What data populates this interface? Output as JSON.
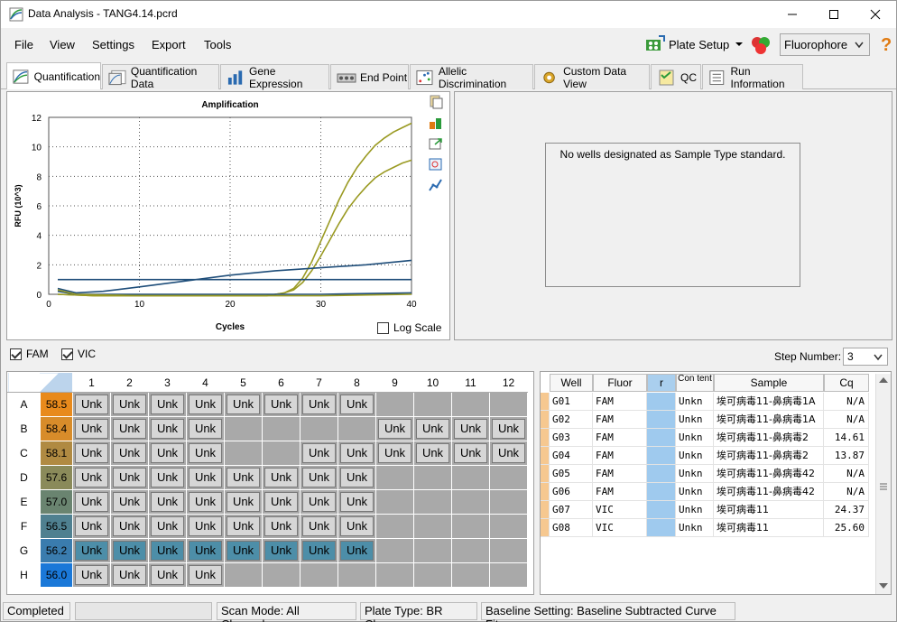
{
  "window": {
    "title": "Data Analysis - TANG4.14.pcrd"
  },
  "menu": {
    "file": "File",
    "view": "View",
    "settings": "Settings",
    "export": "Export",
    "tools": "Tools"
  },
  "toolbar": {
    "plate_setup": "Plate Setup",
    "fluorophore": "Fluorophore"
  },
  "tabs": [
    "Quantification",
    "Quantification Data",
    "Gene Expression",
    "End Point",
    "Allelic Discrimination",
    "Custom Data View",
    "QC",
    "Run Information"
  ],
  "chart_data": {
    "type": "line",
    "title": "Amplification",
    "xlabel": "Cycles",
    "ylabel": "RFU (10^3)",
    "xlim": [
      0,
      40
    ],
    "ylim": [
      0,
      12
    ],
    "xticks": [
      0,
      10,
      20,
      30,
      40
    ],
    "yticks": [
      0,
      2,
      4,
      6,
      8,
      10,
      12
    ],
    "grid": true,
    "series": [
      {
        "color": "#9a9a22",
        "x": [
          1,
          5,
          10,
          15,
          20,
          22,
          24,
          25,
          26,
          27,
          28,
          29,
          30,
          31,
          32,
          33,
          34,
          35,
          36,
          37,
          38,
          39,
          40
        ],
        "y": [
          0,
          -0.1,
          -0.1,
          -0.1,
          -0.1,
          -0.1,
          -0.1,
          0,
          0.1,
          0.4,
          1.1,
          2.2,
          3.6,
          5.0,
          6.4,
          7.6,
          8.6,
          9.4,
          10.1,
          10.6,
          11.0,
          11.3,
          11.6
        ]
      },
      {
        "color": "#9a9a22",
        "x": [
          1,
          5,
          10,
          15,
          20,
          22,
          24,
          25,
          26,
          27,
          28,
          29,
          30,
          31,
          32,
          33,
          34,
          35,
          36,
          37,
          38,
          39,
          40
        ],
        "y": [
          0,
          -0.1,
          -0.1,
          -0.1,
          -0.1,
          -0.1,
          -0.1,
          0,
          0.1,
          0.3,
          0.8,
          1.6,
          2.6,
          3.7,
          4.8,
          5.8,
          6.6,
          7.3,
          7.9,
          8.3,
          8.6,
          8.9,
          9.1
        ]
      },
      {
        "color": "#1f4e7a",
        "x": [
          1,
          40
        ],
        "y": [
          1.0,
          1.0
        ]
      },
      {
        "color": "#1f4e7a",
        "x": [
          1,
          3,
          6,
          10,
          15,
          20,
          25,
          30,
          35,
          40
        ],
        "y": [
          0.4,
          0.1,
          0.2,
          0.5,
          0.9,
          1.3,
          1.6,
          1.8,
          2.0,
          2.3
        ]
      },
      {
        "color": "#1f4e7a",
        "x": [
          1,
          3,
          10,
          20,
          30,
          40
        ],
        "y": [
          0.2,
          0,
          0,
          0,
          0,
          0.1
        ]
      },
      {
        "color": "#9a9a22",
        "x": [
          1,
          3,
          10,
          20,
          30,
          40
        ],
        "y": [
          0.3,
          0,
          -0.1,
          -0.1,
          -0.1,
          0
        ]
      }
    ]
  },
  "log_scale": {
    "label": "Log Scale",
    "checked": false
  },
  "standard_message": "No wells designated as Sample Type standard.",
  "fluor_filters": [
    {
      "label": "FAM",
      "checked": true
    },
    {
      "label": "VIC",
      "checked": true
    }
  ],
  "step_number": {
    "label": "Step Number:",
    "value": "3"
  },
  "plate": {
    "columns": [
      "1",
      "2",
      "3",
      "4",
      "5",
      "6",
      "7",
      "8",
      "9",
      "10",
      "11",
      "12"
    ],
    "rows": [
      {
        "id": "A",
        "temp": "58.5",
        "color": "#e88a1c",
        "wells": [
          "Unk",
          "Unk",
          "Unk",
          "Unk",
          "Unk",
          "Unk",
          "Unk",
          "Unk",
          "",
          "",
          "",
          ""
        ],
        "selected": false
      },
      {
        "id": "B",
        "temp": "58.4",
        "color": "#d88c2a",
        "wells": [
          "Unk",
          "Unk",
          "Unk",
          "Unk",
          "",
          "",
          "",
          "",
          "Unk",
          "Unk",
          "Unk",
          "Unk"
        ],
        "selected": false
      },
      {
        "id": "C",
        "temp": "58.1",
        "color": "#b08a42",
        "wells": [
          "Unk",
          "Unk",
          "Unk",
          "Unk",
          "",
          "",
          "Unk",
          "Unk",
          "Unk",
          "Unk",
          "Unk",
          "Unk"
        ],
        "selected": false
      },
      {
        "id": "D",
        "temp": "57.6",
        "color": "#8a8a5a",
        "wells": [
          "Unk",
          "Unk",
          "Unk",
          "Unk",
          "Unk",
          "Unk",
          "Unk",
          "Unk",
          "",
          "",
          "",
          ""
        ],
        "selected": false
      },
      {
        "id": "E",
        "temp": "57.0",
        "color": "#6a8470",
        "wells": [
          "Unk",
          "Unk",
          "Unk",
          "Unk",
          "Unk",
          "Unk",
          "Unk",
          "Unk",
          "",
          "",
          "",
          ""
        ],
        "selected": false
      },
      {
        "id": "F",
        "temp": "56.5",
        "color": "#4f8090",
        "wells": [
          "Unk",
          "Unk",
          "Unk",
          "Unk",
          "Unk",
          "Unk",
          "Unk",
          "Unk",
          "",
          "",
          "",
          ""
        ],
        "selected": false
      },
      {
        "id": "G",
        "temp": "56.2",
        "color": "#3a7cae",
        "wells": [
          "Unk",
          "Unk",
          "Unk",
          "Unk",
          "Unk",
          "Unk",
          "Unk",
          "Unk",
          "",
          "",
          "",
          ""
        ],
        "selected": true
      },
      {
        "id": "H",
        "temp": "56.0",
        "color": "#1a78d8",
        "wells": [
          "Unk",
          "Unk",
          "Unk",
          "Unk",
          "",
          "",
          "",
          "",
          "",
          "",
          "",
          ""
        ],
        "selected": false
      }
    ]
  },
  "grid": {
    "headers": [
      "Well",
      "Fluor",
      "r",
      "Con tent",
      "Sample",
      "Cq"
    ],
    "rows": [
      {
        "well": "G01",
        "fluor": "FAM",
        "content": "Unkn",
        "sample": "埃可病毒11-鼻病毒1A",
        "cq": "N/A"
      },
      {
        "well": "G02",
        "fluor": "FAM",
        "content": "Unkn",
        "sample": "埃可病毒11-鼻病毒1A",
        "cq": "N/A"
      },
      {
        "well": "G03",
        "fluor": "FAM",
        "content": "Unkn",
        "sample": "埃可病毒11-鼻病毒2",
        "cq": "14.61"
      },
      {
        "well": "G04",
        "fluor": "FAM",
        "content": "Unkn",
        "sample": "埃可病毒11-鼻病毒2",
        "cq": "13.87"
      },
      {
        "well": "G05",
        "fluor": "FAM",
        "content": "Unkn",
        "sample": "埃可病毒11-鼻病毒42",
        "cq": "N/A"
      },
      {
        "well": "G06",
        "fluor": "FAM",
        "content": "Unkn",
        "sample": "埃可病毒11-鼻病毒42",
        "cq": "N/A"
      },
      {
        "well": "G07",
        "fluor": "VIC",
        "content": "Unkn",
        "sample": "埃可病毒11",
        "cq": "24.37"
      },
      {
        "well": "G08",
        "fluor": "VIC",
        "content": "Unkn",
        "sample": "埃可病毒11",
        "cq": "25.60"
      }
    ]
  },
  "status": {
    "state": "Completed",
    "scan_mode": "Scan Mode: All Channels",
    "plate_type": "Plate Type: BR Clear",
    "baseline": "Baseline Setting: Baseline Subtracted Curve Fit"
  }
}
